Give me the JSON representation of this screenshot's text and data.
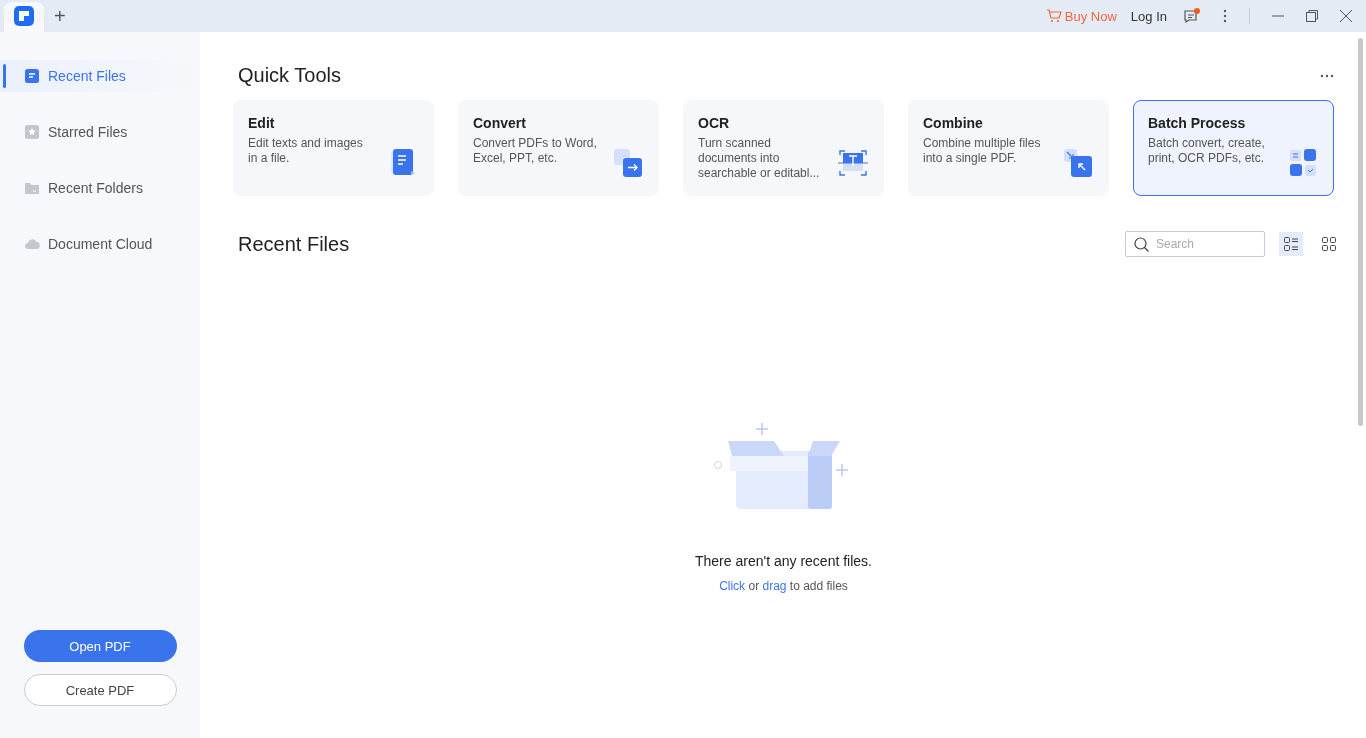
{
  "titlebar": {
    "new_tab": "+",
    "buy_now": "Buy Now",
    "login": "Log In",
    "has_notification": true
  },
  "sidebar": {
    "items": [
      {
        "label": "Recent Files",
        "selected": true,
        "kind": "file"
      },
      {
        "label": "Starred Files",
        "selected": false,
        "kind": "star"
      },
      {
        "label": "Recent Folders",
        "selected": false,
        "kind": "folder"
      },
      {
        "label": "Document Cloud",
        "selected": false,
        "kind": "cloud"
      }
    ],
    "buttons": [
      {
        "label": "Open PDF",
        "kind": "primary"
      },
      {
        "label": "Create PDF",
        "kind": "secondary"
      }
    ]
  },
  "quick_tools": {
    "title": "Quick Tools",
    "tools": [
      {
        "title": "Edit",
        "description": "Edit texts and images in a file.",
        "kind": "edit",
        "selected": false
      },
      {
        "title": "Convert",
        "description": "Convert PDFs to Word, Excel, PPT, etc.",
        "kind": "convert",
        "selected": false
      },
      {
        "title": "OCR",
        "description": "Turn scanned documents into searchable or editabl...",
        "kind": "ocr",
        "selected": false
      },
      {
        "title": "Combine",
        "description": "Combine multiple files into a single PDF.",
        "kind": "combine",
        "selected": false
      },
      {
        "title": "Batch Process",
        "description": "Batch convert, create, print, OCR PDFs, etc.",
        "kind": "batch",
        "selected": true
      }
    ]
  },
  "recent_files": {
    "title": "Recent Files",
    "search": {
      "placeholder": "Search"
    },
    "views": [
      {
        "kind": "list",
        "selected": true
      },
      {
        "kind": "grid",
        "selected": false
      }
    ],
    "empty": {
      "message": "There aren't any recent files.",
      "hint": [
        {
          "text": "Click",
          "kind": "link"
        },
        {
          "text": " or ",
          "kind": "text"
        },
        {
          "text": "drag",
          "kind": "link"
        },
        {
          "text": " to add files",
          "kind": "text"
        }
      ]
    }
  }
}
